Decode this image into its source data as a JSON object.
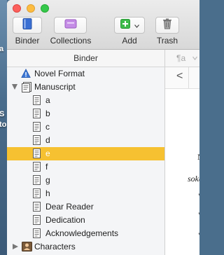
{
  "toolbar": {
    "binder_label": "Binder",
    "collections_label": "Collections",
    "add_label": "Add",
    "trash_label": "Trash"
  },
  "desktop": {
    "label_a": "a",
    "label_b": "S",
    "label_c": "to"
  },
  "binder": {
    "header": "Binder",
    "items": [
      {
        "label": "Novel Format",
        "icon": "info-icon"
      },
      {
        "label": "Manuscript",
        "icon": "manuscript-icon"
      },
      {
        "label": "a",
        "icon": "document-icon"
      },
      {
        "label": "b",
        "icon": "document-icon"
      },
      {
        "label": "c",
        "icon": "document-icon"
      },
      {
        "label": "d",
        "icon": "document-icon"
      },
      {
        "label": "e",
        "icon": "document-icon"
      },
      {
        "label": "f",
        "icon": "document-icon"
      },
      {
        "label": "g",
        "icon": "document-icon"
      },
      {
        "label": "h",
        "icon": "document-icon"
      },
      {
        "label": "Dear Reader",
        "icon": "document-icon"
      },
      {
        "label": "Dedication",
        "icon": "document-icon"
      },
      {
        "label": "Acknowledgements",
        "icon": "document-icon"
      },
      {
        "label": "Characters",
        "icon": "characters-icon"
      }
    ],
    "selected_index": 6
  },
  "editor": {
    "format_glyph": "¶a",
    "back_glyph": "<",
    "text_line1": "N",
    "text_line2": "sokaiy",
    "text_line3": "\"",
    "text_line4": "\"",
    "text_line5": "\""
  },
  "colors": {
    "selection": "#f6c131",
    "collections_icon": "#c58de6",
    "add_icon": "#3dbb4a"
  }
}
